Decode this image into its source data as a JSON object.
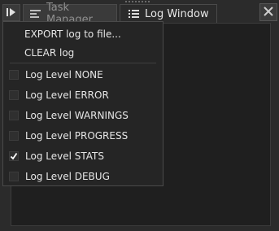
{
  "tabs": [
    {
      "label": "Task Manager",
      "active": false,
      "icon": "task-manager-icon"
    },
    {
      "label": "Log Window",
      "active": true,
      "icon": "list-icon"
    }
  ],
  "toolbar": {
    "panel_toggle_icon": "panel-toggle-icon",
    "close_icon": "close-icon"
  },
  "menu": {
    "actions": [
      {
        "label": "EXPORT log to file..."
      },
      {
        "label": "CLEAR log"
      }
    ],
    "log_levels": [
      {
        "label": "Log Level NONE",
        "checked": false
      },
      {
        "label": "Log Level ERROR",
        "checked": false
      },
      {
        "label": "Log Level WARNINGS",
        "checked": false
      },
      {
        "label": "Log Level PROGRESS",
        "checked": false
      },
      {
        "label": "Log Level STATS",
        "checked": true
      },
      {
        "label": "Log Level DEBUG",
        "checked": false
      }
    ]
  },
  "colors": {
    "background": "#2b2b2b",
    "menu_background": "#252525",
    "text": "#e6e6e6",
    "inactive_tab_text": "#8f8f8f"
  }
}
